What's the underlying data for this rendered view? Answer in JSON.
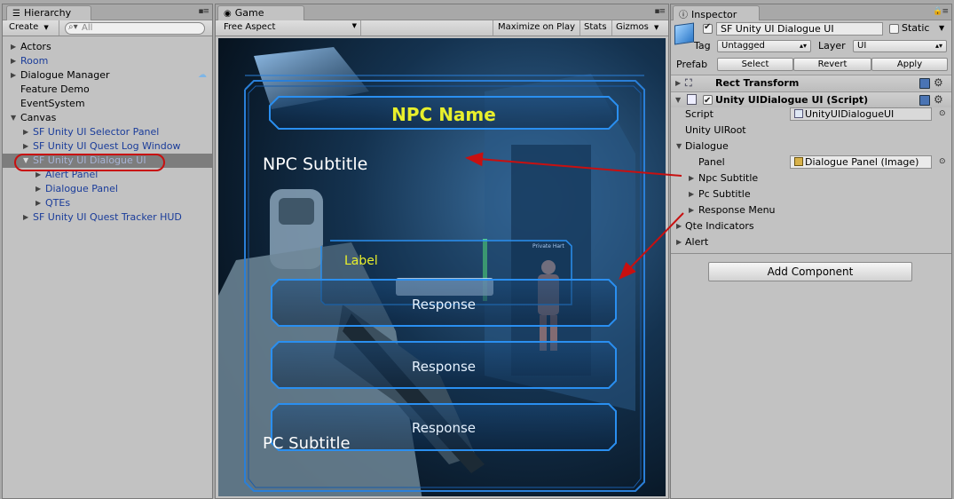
{
  "colors": {
    "panel_bg": "#c2c2c2",
    "selection_bg": "#7d7d7d",
    "annotation_red": "#c81010",
    "game_frame_blue": "#2a7fd8",
    "npc_name_yellow": "#e8ef2c"
  },
  "hierarchy": {
    "tab_label": "Hierarchy",
    "create_label": "Create",
    "search_placeholder": "All",
    "items": [
      {
        "label": "Actors"
      },
      {
        "label": "Room"
      },
      {
        "label": "Dialogue Manager"
      },
      {
        "label": "Feature Demo"
      },
      {
        "label": "EventSystem"
      },
      {
        "label": "Canvas"
      },
      {
        "label": "SF Unity UI Selector Panel"
      },
      {
        "label": "SF Unity UI Quest Log Window"
      },
      {
        "label": "SF Unity UI Dialogue UI"
      },
      {
        "label": "Alert Panel"
      },
      {
        "label": "Dialogue Panel"
      },
      {
        "label": "QTEs"
      },
      {
        "label": "SF Unity UI Quest Tracker HUD"
      }
    ]
  },
  "game": {
    "tab_label": "Game",
    "aspect_label": "Free Aspect",
    "maximize_label": "Maximize on Play",
    "stats_label": "Stats",
    "gizmos_label": "Gizmos",
    "npc_name": "NPC Name",
    "npc_subtitle": "NPC Subtitle",
    "label_text": "Label",
    "responses": [
      "Response",
      "Response",
      "Response"
    ],
    "pc_subtitle": "PC Subtitle",
    "scene_tag": "Private Hart"
  },
  "inspector": {
    "tab_label": "Inspector",
    "object_name": "SF Unity UI Dialogue UI",
    "static_label": "Static",
    "tag_label": "Tag",
    "tag_value": "Untagged",
    "layer_label": "Layer",
    "layer_value": "UI",
    "prefab_label": "Prefab",
    "prefab_select": "Select",
    "prefab_revert": "Revert",
    "prefab_apply": "Apply",
    "rect_transform": "Rect Transform",
    "script_component": "Unity UIDialogue UI (Script)",
    "script_label": "Script",
    "script_value": "UnityUIDialogueUI",
    "unity_ui_root": "Unity UIRoot",
    "dialogue": "Dialogue",
    "panel_label": "Panel",
    "panel_value": "Dialogue Panel (Image)",
    "npc_subtitle": "Npc Subtitle",
    "pc_subtitle": "Pc Subtitle",
    "response_menu": "Response Menu",
    "qte_indicators": "Qte Indicators",
    "alert": "Alert",
    "add_component": "Add Component"
  }
}
